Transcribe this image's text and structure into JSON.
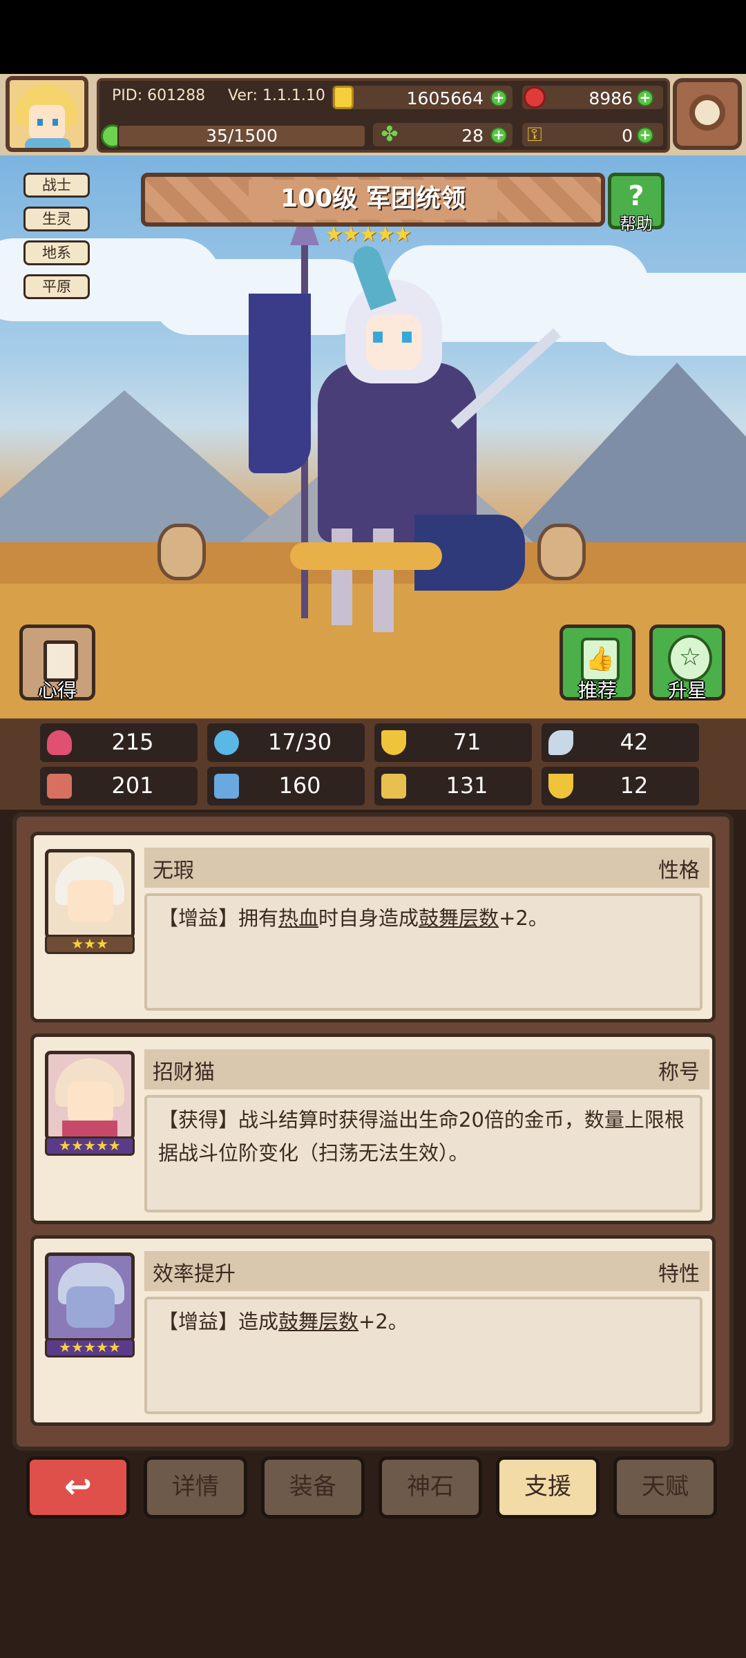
{
  "status": {
    "pid": "PID: 601288",
    "ver": "Ver: 1.1.1.10",
    "gold": "1605664",
    "ruby": "8986",
    "clover": "28",
    "key": "0",
    "energy": "35/1500"
  },
  "tags": [
    "战士",
    "生灵",
    "地系",
    "平原"
  ],
  "hero": {
    "title": "100级  军团统领",
    "stars": "★★★★★",
    "help_label": "帮助"
  },
  "side_buttons": {
    "insight": "心得",
    "recommend": "推荐",
    "upstar": "升星"
  },
  "stats": [
    {
      "name": "hp",
      "value": "215",
      "color": "#e05070"
    },
    {
      "name": "mana",
      "value": "17/30",
      "color": "#5ab8e6"
    },
    {
      "name": "defense",
      "value": "71",
      "color": "#f0c43a"
    },
    {
      "name": "speed",
      "value": "42",
      "color": "#c8d8e8"
    },
    {
      "name": "attack",
      "value": "201",
      "color": "#d87060"
    },
    {
      "name": "magic",
      "value": "160",
      "color": "#6aa8e0"
    },
    {
      "name": "boot",
      "value": "131",
      "color": "#e8c050"
    },
    {
      "name": "luck",
      "value": "12",
      "color": "#f0c43a"
    }
  ],
  "cards": [
    {
      "title": "无瑕",
      "category": "性格",
      "stars": "★★★",
      "text_a": "【增益】拥有",
      "text_u1": "热血",
      "text_b": "时自身造成",
      "text_u2": "鼓舞层数",
      "text_c": "+2。"
    },
    {
      "title": "招财猫",
      "category": "称号",
      "stars": "★★★★★",
      "text": "【获得】战斗结算时获得溢出生命20倍的金币，数量上限根据战斗位阶变化（扫荡无法生效）。"
    },
    {
      "title": "效率提升",
      "category": "特性",
      "stars": "★★★★★",
      "text_a": "【增益】造成",
      "text_u": "鼓舞层数",
      "text_b": "+2。"
    }
  ],
  "nav": [
    "详情",
    "装备",
    "神石",
    "支援",
    "天赋"
  ],
  "accent": {
    "green": "#59c447",
    "red": "#e0504a",
    "gold": "#f7d23a"
  }
}
